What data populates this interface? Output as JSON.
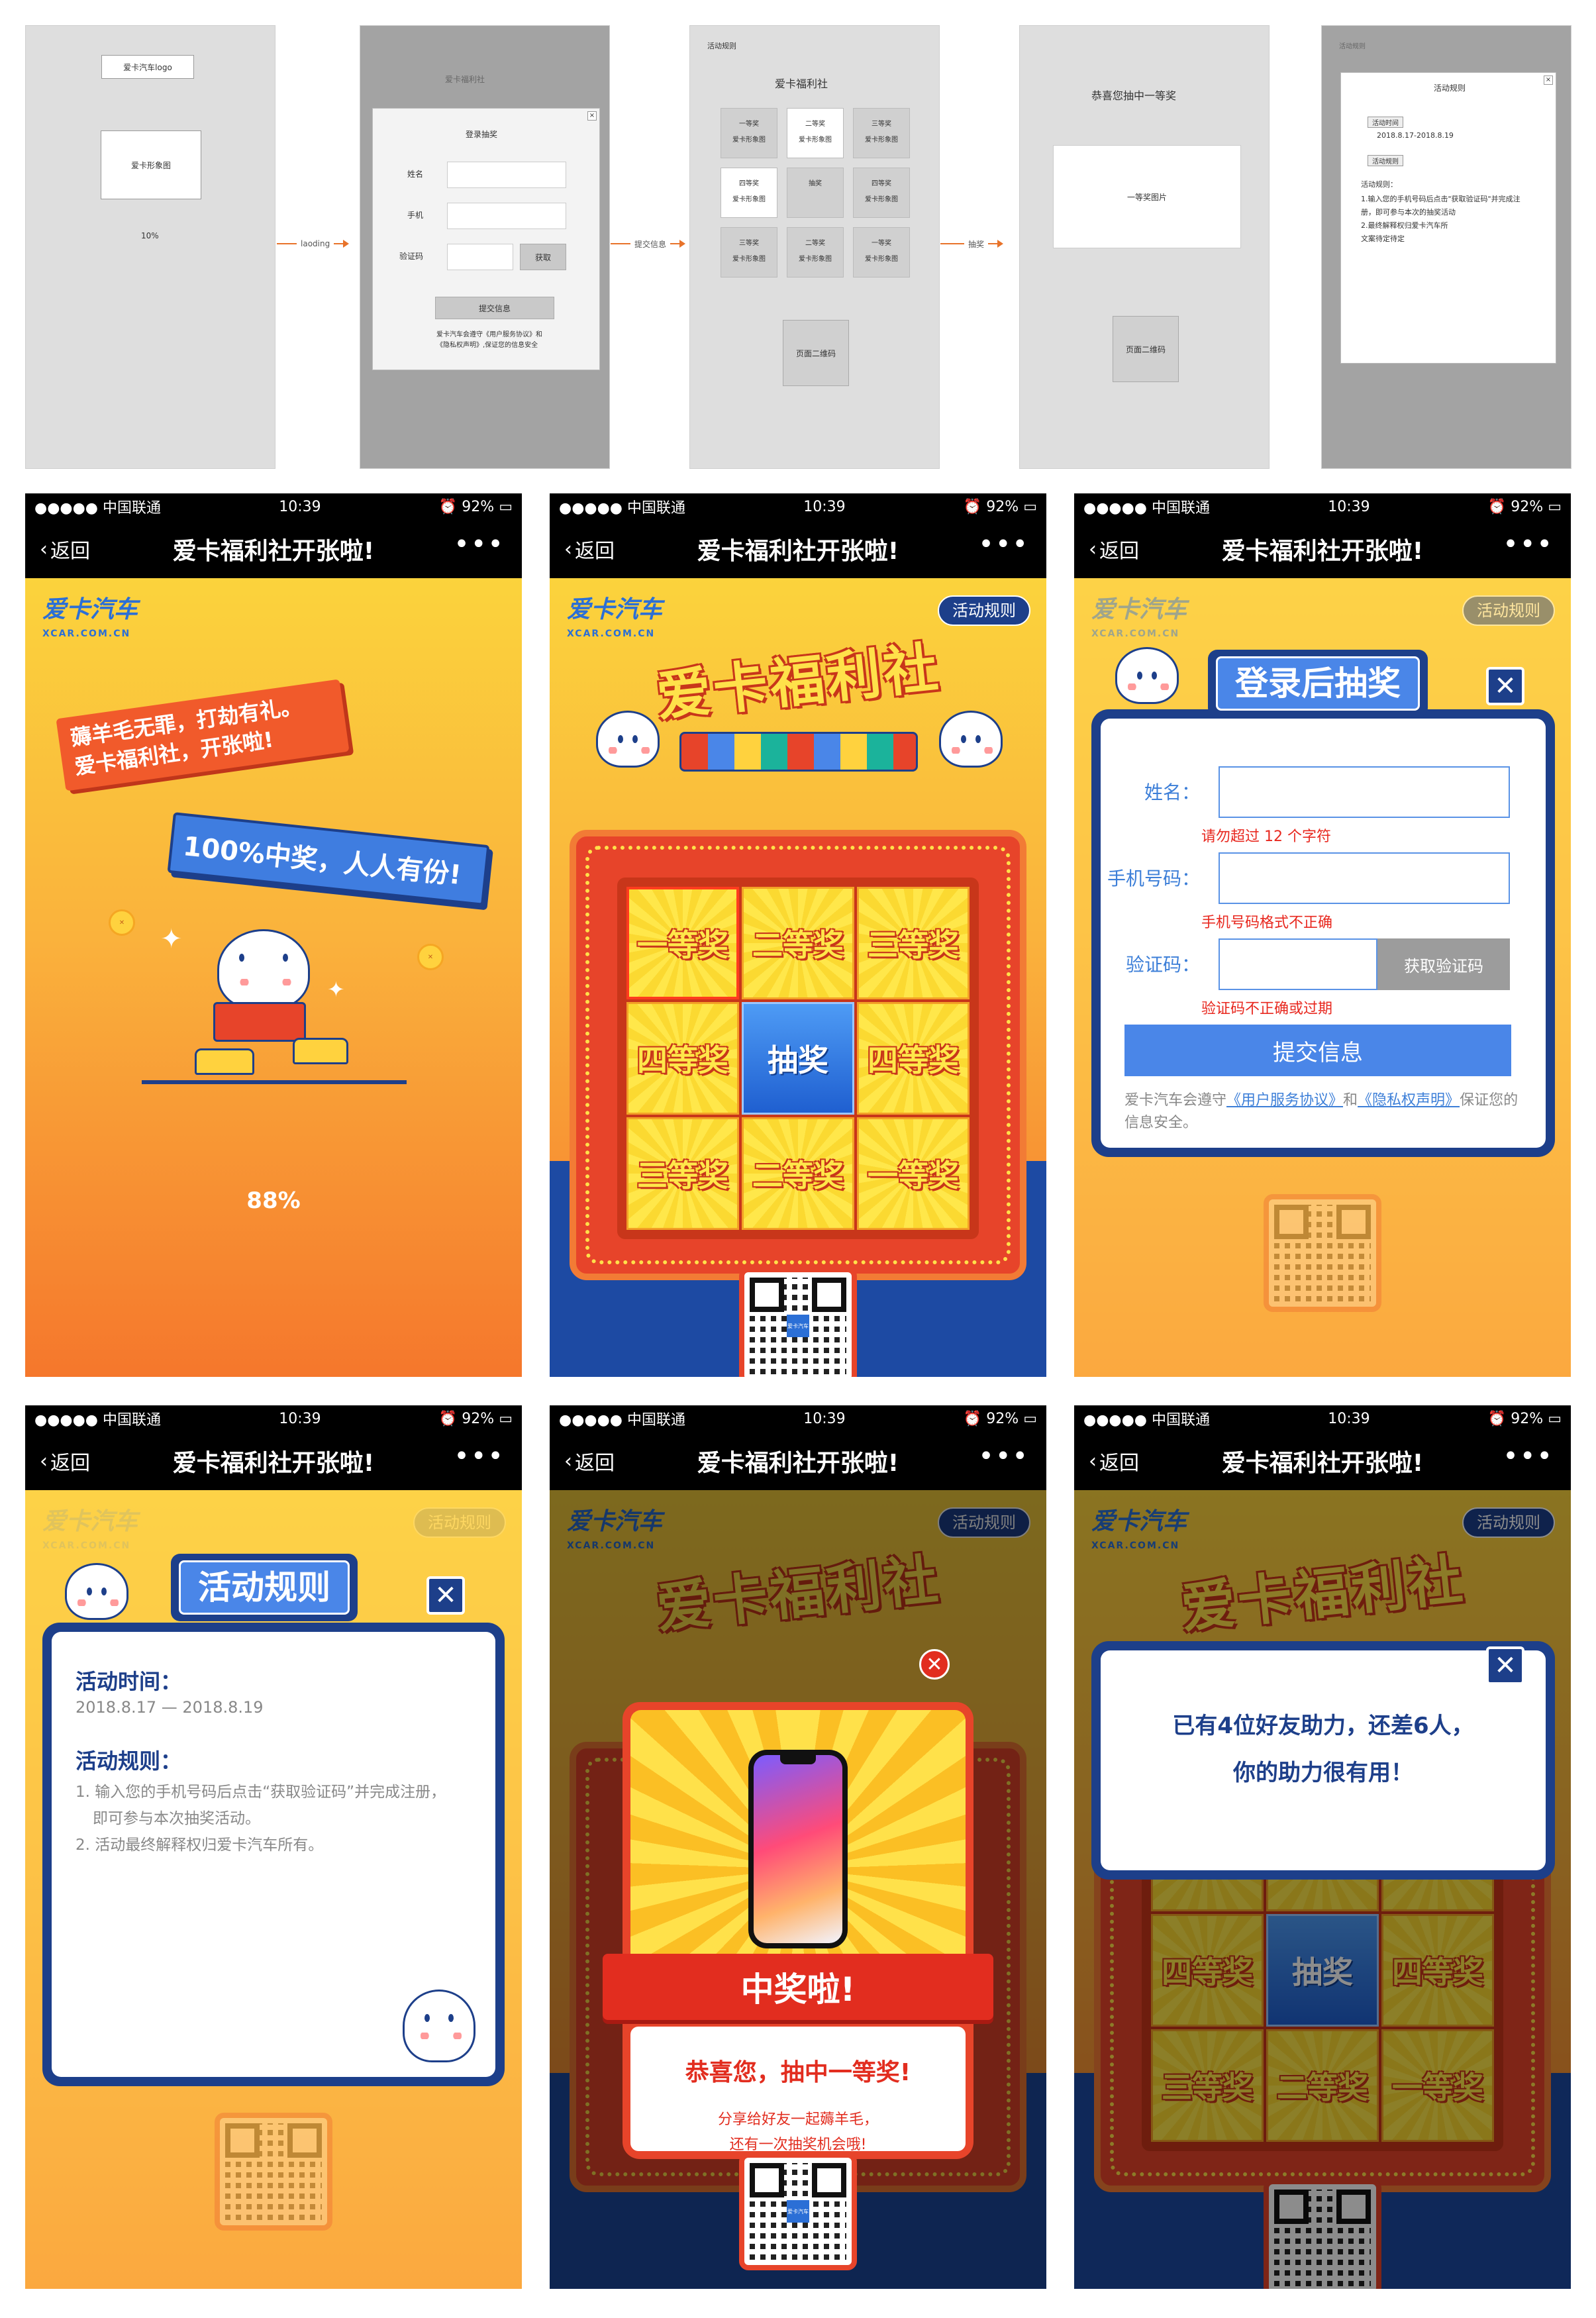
{
  "wireframes": {
    "loading": {
      "logo": "爱卡汽车logo",
      "image": "爱卡形象图",
      "progress": "10%"
    },
    "login": {
      "bg_title": "爱卡福利社",
      "modal_title": "登录抽奖",
      "name_label": "姓名",
      "phone_label": "手机",
      "code_label": "验证码",
      "code_btn": "获取",
      "submit_btn": "提交信息",
      "note_1": "爱卡汽车会遵守《用户服务协议》和",
      "note_2": "《隐私权声明》,保证您的信息安全"
    },
    "lottery": {
      "rules_link": "活动规则",
      "title": "爱卡福利社",
      "cells": [
        {
          "name": "一等奖",
          "sub": "爱卡形象图"
        },
        {
          "name": "二等奖",
          "sub": "爱卡形象图"
        },
        {
          "name": "三等奖",
          "sub": "爱卡形象图"
        },
        {
          "name": "四等奖",
          "sub": "爱卡形象图"
        },
        {
          "name": "抽奖",
          "sub": ""
        },
        {
          "name": "四等奖",
          "sub": "爱卡形象图"
        },
        {
          "name": "三等奖",
          "sub": "爱卡形象图"
        },
        {
          "name": "二等奖",
          "sub": "爱卡形象图"
        },
        {
          "name": "一等奖",
          "sub": "爱卡形象图"
        }
      ],
      "qr": "页面二维码"
    },
    "win": {
      "title": "恭喜您抽中一等奖",
      "image": "一等奖图片",
      "qr": "页面二维码"
    },
    "rules": {
      "bg_label": "活动规则",
      "title": "活动规则",
      "time_tag": "活动时间",
      "time": "2018.8.17-2018.8.19",
      "rules_tag": "活动规则",
      "rules_head": "活动规则：",
      "rule_1": "1.输入您的手机号码后点击\"获取验证码\"并完成注",
      "rule_1b": "册，即可参与本次的抽奖活动",
      "rule_2": "2.最终解释权归爱卡汽车所",
      "rule_3": "文案待定待定"
    },
    "arrows": [
      "laoding",
      "提交信息",
      "抽奖"
    ]
  },
  "statusbar": {
    "carrier": "●●●●● 中国联通",
    "time": "10:39",
    "battery": "92%"
  },
  "navbar": {
    "back": "返回",
    "title": "爱卡福利社开张啦!",
    "more": "•••"
  },
  "brand": {
    "logo": "爱卡汽车",
    "logo_sub": "XCAR.COM.CN",
    "rules_btn": "活动规则",
    "banner": "爱卡福利社"
  },
  "loading_screen": {
    "speech_1a": "薅羊毛无罪，打劫有礼。",
    "speech_1b": "爱卡福利社，开张啦!",
    "speech_2": "100%中奖，人人有份!",
    "progress": "88%"
  },
  "lottery_cells": [
    "一等奖",
    "二等奖",
    "三等奖",
    "四等奖",
    "抽奖",
    "四等奖",
    "三等奖",
    "二等奖",
    "一等奖"
  ],
  "login_modal": {
    "title": "登录后抽奖",
    "name_label": "姓名：",
    "name_error": "请勿超过 12 个字符",
    "phone_label": "手机号码：",
    "phone_error": "手机号码格式不正确",
    "code_label": "验证码：",
    "code_btn": "获取验证码",
    "code_error": "验证码不正确或过期",
    "submit": "提交信息",
    "note_prefix": "爱卡汽车会遵守",
    "agreement": "《用户服务协议》",
    "and": "和",
    "privacy": "《隐私权声明》",
    "note_suffix": "保证您的信息安全。"
  },
  "rules_modal": {
    "title": "活动规则",
    "time_head": "活动时间：",
    "time": "2018.8.17 — 2018.8.19",
    "rules_head": "活动规则：",
    "rule_1": "1. 输入您的手机号码后点击“获取验证码”并完成注册，",
    "rule_1b": "即可参与本次抽奖活动。",
    "rule_2": "2. 活动最终解释权归爱卡汽车所有。"
  },
  "win_modal": {
    "ribbon": "中奖啦!",
    "congrats": "恭喜您，抽中一等奖!",
    "share_1": "分享给好友一起薅羊毛，",
    "share_2": "还有一次抽奖机会哦!"
  },
  "help_modal": {
    "line_1": "已有4位好友助力，还差6人，",
    "line_2": "你的助力很有用！"
  },
  "qr_center": "爱卡汽车"
}
